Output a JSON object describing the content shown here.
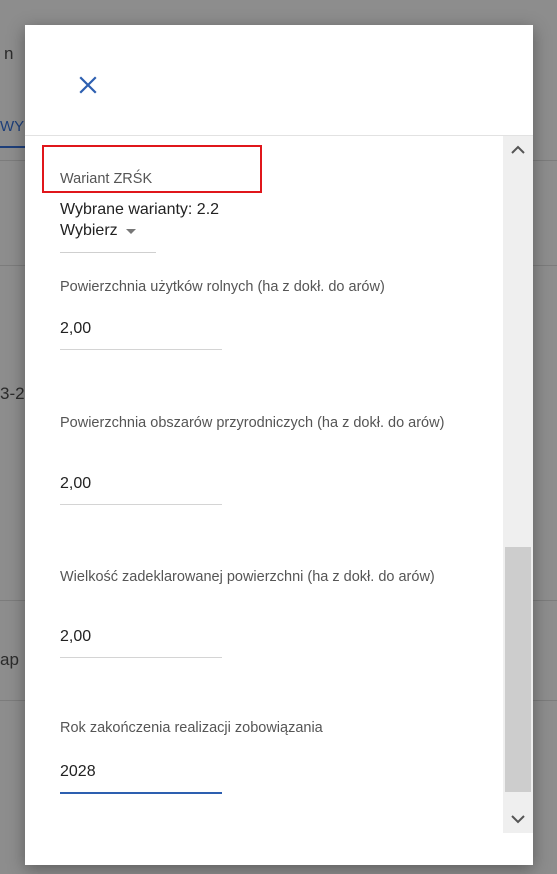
{
  "background": {
    "fragments": [
      "n",
      "WY",
      "3-2",
      "ap"
    ]
  },
  "dialog": {
    "close_icon": "close-icon",
    "accent_color": "#2d5fb0",
    "highlight_color": "#e0161b",
    "fields": {
      "variant": {
        "label": "Wariant ZRŚK",
        "selected": "Wybrane warianty: 2.2",
        "select_label": "Wybierz"
      },
      "agricultural_area": {
        "label": "Powierzchnia użytków rolnych (ha z dokł. do arów)",
        "value": "2,00"
      },
      "natural_area": {
        "label": "Powierzchnia obszarów przyrodniczych (ha z dokł. do arów)",
        "value": "2,00"
      },
      "declared_area": {
        "label": "Wielkość zadeklarowanej powierzchni (ha z dokł. do arów)",
        "value": "2,00"
      },
      "end_year": {
        "label": "Rok zakończenia realizacji zobowiązania",
        "value": "2028"
      }
    }
  }
}
